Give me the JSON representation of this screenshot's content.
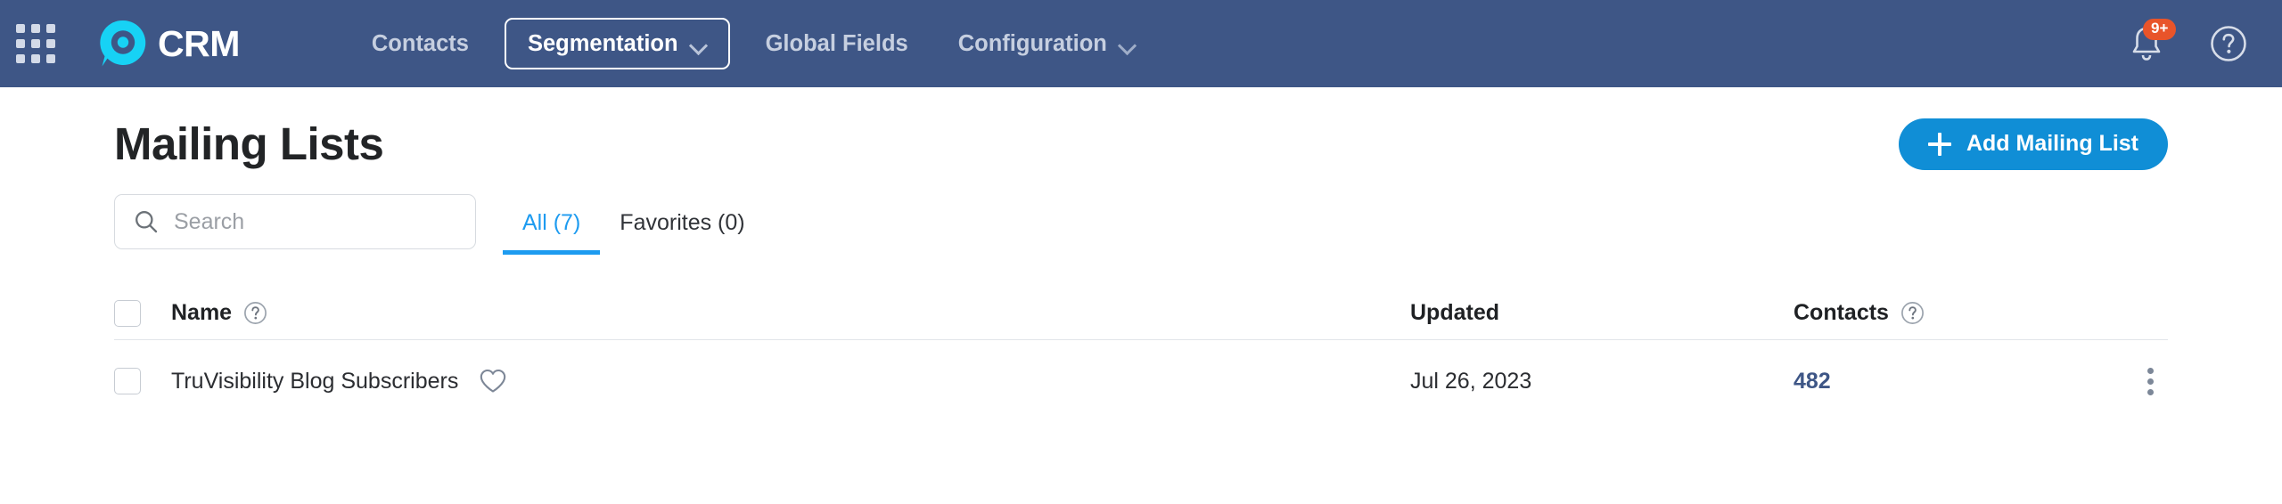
{
  "topbar": {
    "app_launcher_icon": "grid-apps-icon",
    "brand": {
      "logo_icon": "truvisibility-logo-icon",
      "text": "CRM"
    },
    "nav": [
      {
        "label": "Contacts",
        "active": false,
        "has_caret": false
      },
      {
        "label": "Segmentation",
        "active": true,
        "has_caret": true
      },
      {
        "label": "Global Fields",
        "active": false,
        "has_caret": false
      },
      {
        "label": "Configuration",
        "active": false,
        "has_caret": true
      }
    ],
    "notifications": {
      "icon": "bell-icon",
      "badge": "9+"
    },
    "help": {
      "icon": "help-circle-icon"
    },
    "colors": {
      "bar_bg": "#3e5686",
      "logo_cyan": "#17d2f5",
      "badge": "#e8542a"
    }
  },
  "page": {
    "title": "Mailing Lists",
    "add_button": {
      "label": "Add Mailing List",
      "icon": "plus-icon",
      "color": "#108ed6"
    }
  },
  "search": {
    "placeholder": "Search",
    "value": "",
    "icon": "search-icon"
  },
  "tabs": [
    {
      "label": "All (7)",
      "active": true
    },
    {
      "label": "Favorites (0)",
      "active": false
    }
  ],
  "table": {
    "columns": {
      "name": "Name",
      "updated": "Updated",
      "contacts": "Contacts"
    },
    "rows": [
      {
        "name": "TruVisibility Blog Subscribers",
        "updated": "Jul 26, 2023",
        "contacts": "482",
        "favorite_icon": "heart-outline-icon",
        "menu_icon": "kebab-menu-icon"
      }
    ]
  }
}
